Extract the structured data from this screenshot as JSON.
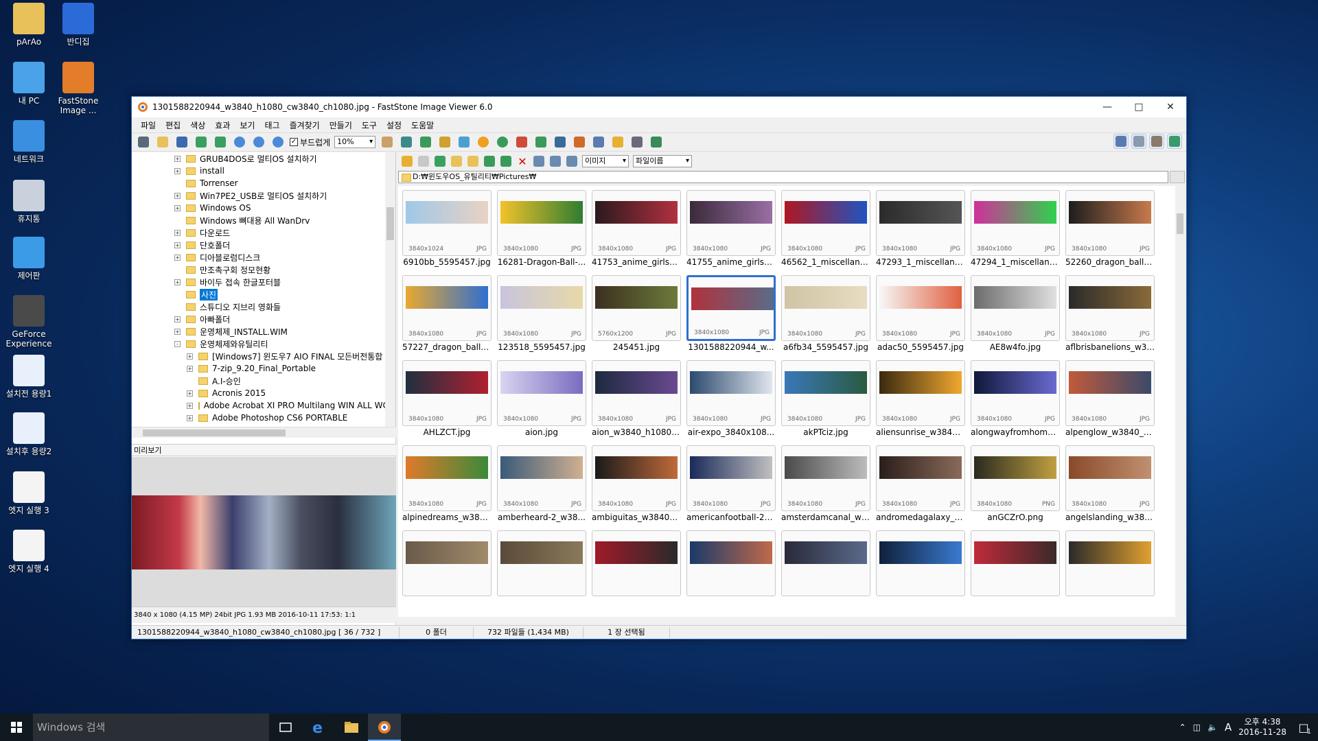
{
  "desktop": {
    "icons": [
      {
        "label": "pArAo",
        "icon": "user-folder-icon",
        "color": "#e8c15a"
      },
      {
        "label": "반디집",
        "icon": "bandizip-icon",
        "color": "#2a6bd8"
      },
      {
        "label": "내 PC",
        "icon": "computer-icon",
        "color": "#4aa3e8"
      },
      {
        "label": "FastStone Image ...",
        "icon": "faststone-icon",
        "color": "#e37d2a"
      },
      {
        "label": "네트워크",
        "icon": "network-icon",
        "color": "#3a8fe0"
      },
      {
        "label": "휴지통",
        "icon": "recycle-bin-icon",
        "color": "#c9d2dc"
      },
      {
        "label": "제어판",
        "icon": "control-panel-icon",
        "color": "#3b9be6"
      },
      {
        "label": "GeForce Experience",
        "icon": "geforce-icon",
        "color": "#4a4a4a"
      },
      {
        "label": "설치전 용량1",
        "icon": "shortcut-icon",
        "color": "#e8f0fb"
      },
      {
        "label": "설치후 용량2",
        "icon": "shortcut-icon",
        "color": "#e8f0fb"
      },
      {
        "label": "엣지 실행 3",
        "icon": "shortcut-icon",
        "color": "#f4f4f4"
      },
      {
        "label": "엣지 실행 4",
        "icon": "shortcut-icon",
        "color": "#f4f4f4"
      }
    ]
  },
  "window": {
    "title": "1301588220944_w3840_h1080_cw3840_ch1080.jpg  -  FastStone Image Viewer 6.0",
    "menu": [
      "파일",
      "편집",
      "색상",
      "효과",
      "보기",
      "태그",
      "즐겨찾기",
      "만들기",
      "도구",
      "설정",
      "도움말"
    ],
    "smooth_label": "부드럽게",
    "zoom": "10%",
    "filter": "이미지",
    "sort": "파일이름",
    "path": "D:₩윈도우OS_유틸리티₩Pictures₩"
  },
  "tree": [
    {
      "label": "GRUB4DOS로 멀티OS 설치하기",
      "depth": 3,
      "exp": "+"
    },
    {
      "label": "install",
      "depth": 3,
      "exp": "+"
    },
    {
      "label": "Torrenser",
      "depth": 3,
      "exp": ""
    },
    {
      "label": "Win7PE2_USB로 멀티OS 설치하기",
      "depth": 3,
      "exp": "+"
    },
    {
      "label": "Windows OS",
      "depth": 3,
      "exp": "+"
    },
    {
      "label": "Windows 뼈대용 All WanDrv",
      "depth": 3,
      "exp": ""
    },
    {
      "label": "다운로드",
      "depth": 3,
      "exp": "+"
    },
    {
      "label": "단호폴더",
      "depth": 3,
      "exp": "+"
    },
    {
      "label": "디아블로럼디스크",
      "depth": 3,
      "exp": "+"
    },
    {
      "label": "만조촉구회 정모현황",
      "depth": 3,
      "exp": ""
    },
    {
      "label": "바이두 접속 한글포터블",
      "depth": 3,
      "exp": "+"
    },
    {
      "label": "사진",
      "depth": 3,
      "exp": "",
      "selected": true
    },
    {
      "label": "스튜디오 지브리 영화들",
      "depth": 3,
      "exp": ""
    },
    {
      "label": "아빠폴더",
      "depth": 3,
      "exp": "+"
    },
    {
      "label": "운영체제_INSTALL.WIM",
      "depth": 3,
      "exp": "+"
    },
    {
      "label": "운영체제와유틸리티",
      "depth": 3,
      "exp": "-"
    },
    {
      "label": "[Windows7] 윈도우7  AIO FINAL 모든버전통합",
      "depth": 4,
      "exp": "+"
    },
    {
      "label": "7-zip_9.20_Final_Portable",
      "depth": 4,
      "exp": "+"
    },
    {
      "label": "A.I-승인",
      "depth": 4,
      "exp": ""
    },
    {
      "label": "Acronis 2015",
      "depth": 4,
      "exp": "+"
    },
    {
      "label": "Adobe Acrobat XI PRO Multilang WIN ALL WC",
      "depth": 4,
      "exp": "+"
    },
    {
      "label": "Adobe Photoshop CS6 PORTABLE",
      "depth": 4,
      "exp": "+"
    }
  ],
  "preview": {
    "header": "미리보기",
    "info": "3840 x 1080 (4.15 MP)  24bit  JPG   1.93 MB   2016-10-11 17:53:  1:1"
  },
  "thumbnails": [
    {
      "name": "6910bb_5595457.jpg",
      "dims": "3840x1024",
      "ext": "JPG",
      "c1": "#9fc8e8",
      "c2": "#e9d2c4"
    },
    {
      "name": "16281-Dragon-Ball-...",
      "dims": "3840x1080",
      "ext": "JPG",
      "c1": "#f3c22a",
      "c2": "#2e7d32"
    },
    {
      "name": "41753_anime_girls_...",
      "dims": "3840x1080",
      "ext": "JPG",
      "c1": "#2a1a1e",
      "c2": "#b23040"
    },
    {
      "name": "41755_anime_girls_...",
      "dims": "3840x1080",
      "ext": "JPG",
      "c1": "#3a2a3a",
      "c2": "#9a6fa5"
    },
    {
      "name": "46562_1_miscellane...",
      "dims": "3840x1080",
      "ext": "JPG",
      "c1": "#b01722",
      "c2": "#1f55c0"
    },
    {
      "name": "47293_1_miscellane...",
      "dims": "3840x1080",
      "ext": "JPG",
      "c1": "#2b2b2b",
      "c2": "#555555"
    },
    {
      "name": "47294_1_miscellane...",
      "dims": "3840x1080",
      "ext": "JPG",
      "c1": "#d12f9c",
      "c2": "#2fd14c"
    },
    {
      "name": "52260_dragon_ball_...",
      "dims": "3840x1080",
      "ext": "JPG",
      "c1": "#1d1d1d",
      "c2": "#c77a4c"
    },
    {
      "name": "57227_dragon_ball_...",
      "dims": "3840x1080",
      "ext": "JPG",
      "c1": "#e9a830",
      "c2": "#2f6fd0"
    },
    {
      "name": "123518_5595457.jpg",
      "dims": "3840x1080",
      "ext": "JPG",
      "c1": "#c8c4dc",
      "c2": "#e8d9a8"
    },
    {
      "name": "245451.jpg",
      "dims": "5760x1200",
      "ext": "JPG",
      "c1": "#3c3020",
      "c2": "#6c7a3a"
    },
    {
      "name": "1301588220944_w...",
      "dims": "3840x1080",
      "ext": "JPG",
      "c1": "#b0323d",
      "c2": "#5a6c88",
      "selected": true
    },
    {
      "name": "a6fb34_5595457.jpg",
      "dims": "3840x1080",
      "ext": "JPG",
      "c1": "#cfc4a4",
      "c2": "#e8dcc2"
    },
    {
      "name": "adac50_5595457.jpg",
      "dims": "3840x1080",
      "ext": "JPG",
      "c1": "#f7f7f7",
      "c2": "#e06040"
    },
    {
      "name": "AE8w4fo.jpg",
      "dims": "3840x1080",
      "ext": "JPG",
      "c1": "#6c6c6c",
      "c2": "#e0e0e0"
    },
    {
      "name": "aflbrisbanelions_w3...",
      "dims": "3840x1080",
      "ext": "JPG",
      "c1": "#2a2a2a",
      "c2": "#8a6a3a"
    },
    {
      "name": "AHLZCT.jpg",
      "dims": "3840x1080",
      "ext": "JPG",
      "c1": "#1f3040",
      "c2": "#b02030"
    },
    {
      "name": "aion.jpg",
      "dims": "3840x1080",
      "ext": "JPG",
      "c1": "#d8d4f0",
      "c2": "#7a6cc0"
    },
    {
      "name": "aion_w3840_h1080_...",
      "dims": "3840x1080",
      "ext": "JPG",
      "c1": "#1e2a40",
      "c2": "#6a4a90"
    },
    {
      "name": "air-expo_3840x108...",
      "dims": "3840x1080",
      "ext": "JPG",
      "c1": "#2c4a6e",
      "c2": "#dfe6ee"
    },
    {
      "name": "akPTciz.jpg",
      "dims": "3840x1080",
      "ext": "JPG",
      "c1": "#3a78b8",
      "c2": "#2a5a40"
    },
    {
      "name": "aliensunrise_w3840_...",
      "dims": "3840x1080",
      "ext": "JPG",
      "c1": "#3a2a10",
      "c2": "#f0a830"
    },
    {
      "name": "alongwayfromhome...",
      "dims": "3840x1080",
      "ext": "JPG",
      "c1": "#10183a",
      "c2": "#6a6ad0"
    },
    {
      "name": "alpenglow_w3840_h...",
      "dims": "3840x1080",
      "ext": "JPG",
      "c1": "#c05a3a",
      "c2": "#3a4a6a"
    },
    {
      "name": "alpinedreams_w384...",
      "dims": "3840x1080",
      "ext": "JPG",
      "c1": "#e07a2a",
      "c2": "#3a8a3a"
    },
    {
      "name": "amberheard-2_w38...",
      "dims": "3840x1080",
      "ext": "JPG",
      "c1": "#3a5a7a",
      "c2": "#d0b090"
    },
    {
      "name": "ambiguitas_w3840_...",
      "dims": "3840x1080",
      "ext": "JPG",
      "c1": "#1a1a1a",
      "c2": "#c06a3a"
    },
    {
      "name": "americanfootball-2_...",
      "dims": "3840x1080",
      "ext": "JPG",
      "c1": "#1a2a5a",
      "c2": "#c0c0c0"
    },
    {
      "name": "amsterdamcanal_w3...",
      "dims": "3840x1080",
      "ext": "JPG",
      "c1": "#4a4a4a",
      "c2": "#bcbcbc"
    },
    {
      "name": "andromedagalaxy_w...",
      "dims": "3840x1080",
      "ext": "JPG",
      "c1": "#2a1e1a",
      "c2": "#8a6a5a"
    },
    {
      "name": "anGCZrO.png",
      "dims": "3840x1080",
      "ext": "PNG",
      "c1": "#2a2a20",
      "c2": "#c0a040"
    },
    {
      "name": "angelslanding_w384...",
      "dims": "3840x1080",
      "ext": "JPG",
      "c1": "#8a4a2a",
      "c2": "#c09070"
    },
    {
      "name": "",
      "dims": "",
      "ext": "",
      "c1": "#6a5a4a",
      "c2": "#a08a6a"
    },
    {
      "name": "",
      "dims": "",
      "ext": "",
      "c1": "#5a4a3a",
      "c2": "#8a7a5a"
    },
    {
      "name": "",
      "dims": "",
      "ext": "",
      "c1": "#a01a2a",
      "c2": "#2a2a2a"
    },
    {
      "name": "",
      "dims": "",
      "ext": "",
      "c1": "#1a3a6a",
      "c2": "#c06a4a"
    },
    {
      "name": "",
      "dims": "",
      "ext": "",
      "c1": "#2a2a3a",
      "c2": "#5a6a8a"
    },
    {
      "name": "",
      "dims": "",
      "ext": "",
      "c1": "#10203a",
      "c2": "#3a7ad0"
    },
    {
      "name": "",
      "dims": "",
      "ext": "",
      "c1": "#c02a3a",
      "c2": "#3a2a2a"
    },
    {
      "name": "",
      "dims": "",
      "ext": "",
      "c1": "#2a2a2a",
      "c2": "#e0a030"
    }
  ],
  "status": {
    "file": "1301588220944_w3840_h1080_cw3840_ch1080.jpg [ 36 / 732 ]",
    "folders": "0 폴더",
    "files": "732 파일들 (1,434 MB)",
    "selected": "1 장 선택됨"
  },
  "taskbar": {
    "search_placeholder": "Windows 검색",
    "time": "오후 4:38",
    "date": "2016-11-28",
    "ime": "A",
    "notification_count": "1"
  },
  "colors": {
    "accent": "#0078d7",
    "selection_border": "#2f6fd0"
  }
}
